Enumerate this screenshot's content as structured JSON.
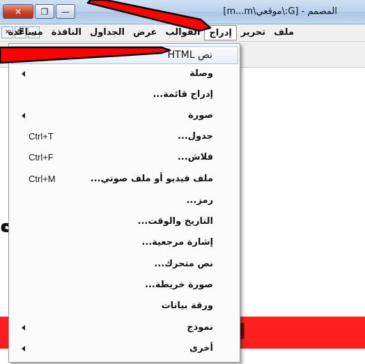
{
  "window": {
    "title": "المصمم - [G:\\موقعي\\m...m]",
    "close_symbol": "✕",
    "maximize_symbol": "❐",
    "minimize_symbol": "—"
  },
  "menubar": {
    "items": [
      {
        "label": "ملف"
      },
      {
        "label": "تحرير"
      },
      {
        "label": "إدراج",
        "active": true
      },
      {
        "label": "القوالب"
      },
      {
        "label": "عرض"
      },
      {
        "label": "الجداول"
      },
      {
        "label": "النافذة"
      },
      {
        "label": "مساعدة"
      }
    ],
    "mdi_close": "✕",
    "mdi_restore": "🗗",
    "mdi_minimize": "_"
  },
  "insert_menu": {
    "items": [
      {
        "label": "نص HTML",
        "latin": true
      },
      {
        "label": "وصلة",
        "submenu": true
      },
      {
        "label": "إدراج قائمة..."
      },
      {
        "label": "صورة",
        "submenu": true
      },
      {
        "label": "جدول...",
        "shortcut": "Ctrl+T"
      },
      {
        "label": "فلاش...",
        "shortcut": "Ctrl+F"
      },
      {
        "label": "ملف فيديو أو ملف صوتي...",
        "shortcut": "Ctrl+M"
      },
      {
        "label": "رمز..."
      },
      {
        "label": "التاريخ والوقت..."
      },
      {
        "label": "إشارة مرجعية..."
      },
      {
        "label": "نص متحرك..."
      },
      {
        "label": "صورة خريطة..."
      },
      {
        "label": "ورقة بيانات"
      },
      {
        "label": "نموذج",
        "submenu": true
      },
      {
        "label": "أخرى",
        "submenu": true
      }
    ]
  },
  "document": {
    "fragment_left": "ه",
    "fragment_banner": "الح"
  },
  "colors": {
    "arrow_fill": "#ff0000",
    "banner": "#ff1f1f",
    "highlight": "#e6eef9"
  }
}
